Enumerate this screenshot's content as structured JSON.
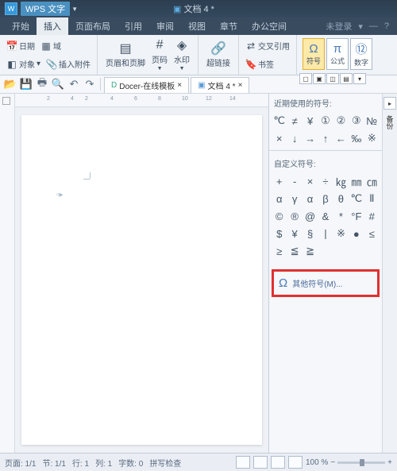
{
  "titlebar": {
    "app": "WPS 文字",
    "doc": "文档 4 *"
  },
  "menu": {
    "items": [
      "开始",
      "插入",
      "页面布局",
      "引用",
      "审阅",
      "视图",
      "章节",
      "办公空间"
    ],
    "login": "未登录"
  },
  "ribbon": {
    "g1": {
      "date": "日期",
      "field": "域",
      "object": "对象",
      "attach": "插入附件"
    },
    "g2": {
      "hf": "页眉和页脚",
      "pn": "页码",
      "wm": "水印"
    },
    "g3": {
      "link": "超链接",
      "xref": "交叉引用",
      "bk": "书签"
    },
    "sym": {
      "symbol": "符号",
      "pi": "π",
      "formula": "公式",
      "num": "数字"
    }
  },
  "tabs": {
    "t1": "Docer-在线模板",
    "t2": "文档 4 *"
  },
  "panel": {
    "recent_hdr": "近期使用的符号:",
    "recent": [
      "℃",
      "≠",
      "¥",
      "①",
      "②",
      "③",
      "№",
      "×",
      "↓",
      "→",
      "↑",
      "←",
      "‰",
      "※"
    ],
    "custom_hdr": "自定义符号:",
    "custom": [
      "+",
      "-",
      "×",
      "÷",
      "㎏",
      "㎜",
      "㎝",
      "α",
      "γ",
      "α",
      "β",
      "θ",
      "℃",
      "Ⅱ",
      "©",
      "®",
      "@",
      "&",
      "*",
      "°F",
      "#",
      "$",
      "¥",
      "§",
      "丨",
      "※",
      "●",
      "≤",
      "≥",
      "≦",
      "≧"
    ],
    "more": "其他符号(M)..."
  },
  "side": {
    "backup": "备份"
  },
  "status": {
    "page": "页面: 1/1",
    "sec": "节: 1/1",
    "ln": "行: 1",
    "col": "列: 1",
    "wc": "字数: 0",
    "spell": "拼写检查",
    "zoom": "100 %"
  }
}
